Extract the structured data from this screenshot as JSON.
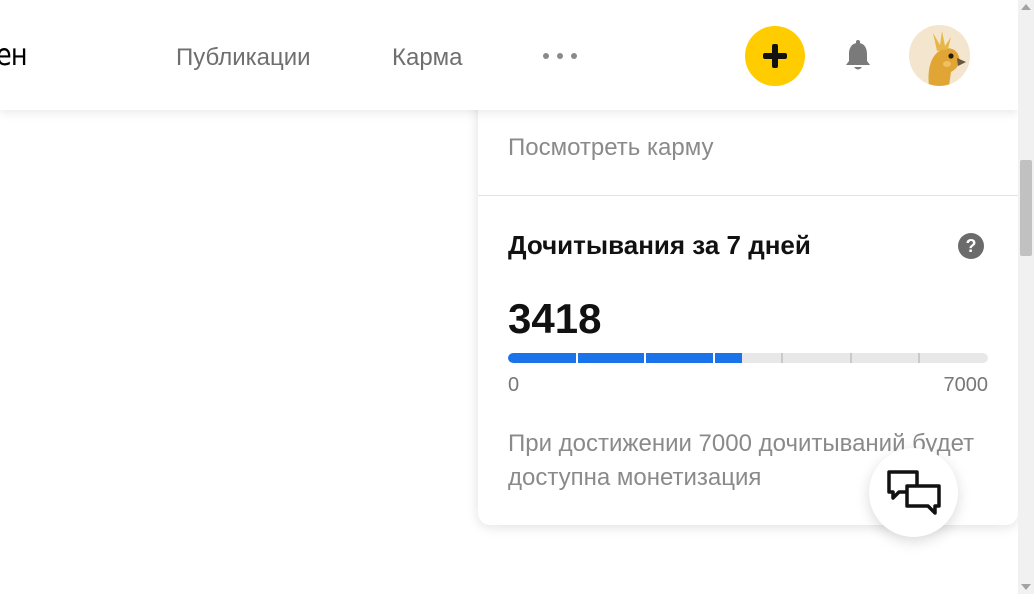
{
  "header": {
    "logo_fragment": "ен",
    "nav": {
      "publications": "Публикации",
      "karma": "Карма"
    },
    "colors": {
      "add_button": "#ffcc00",
      "nav_text": "#6f6f6f"
    },
    "icons": {
      "more": "more-dots-icon",
      "add": "plus-icon",
      "bell": "bell-icon",
      "avatar": "bird-avatar"
    }
  },
  "card": {
    "karma_link": "Посмотреть карму",
    "stats": {
      "title": "Дочитывания за 7 дней",
      "help": "?",
      "value": "3418",
      "progress": {
        "current": 3418,
        "max": 7000,
        "fraction": 0.488,
        "min_label": "0",
        "max_label": "7000",
        "color": "#1a73e8"
      },
      "note": "При достижении 7000 дочитываний будет доступна монетизация"
    }
  },
  "chat_button": {
    "icon": "chat-bubbles-icon"
  }
}
